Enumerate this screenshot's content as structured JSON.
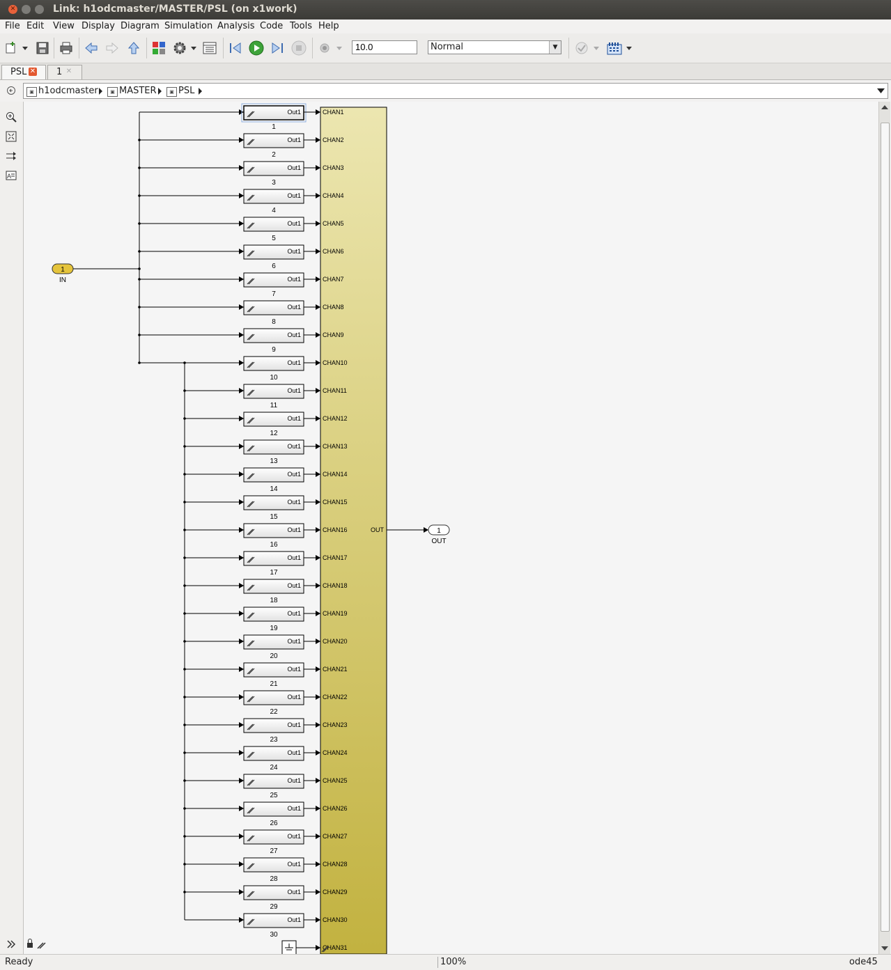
{
  "window": {
    "title": "Link: h1odcmaster/MASTER/PSL (on x1work)"
  },
  "menu": [
    "File",
    "Edit",
    "View",
    "Display",
    "Diagram",
    "Simulation",
    "Analysis",
    "Code",
    "Tools",
    "Help"
  ],
  "toolbar": {
    "stop_time": "10.0",
    "sim_mode": "Normal"
  },
  "tabs": [
    {
      "label": "PSL"
    },
    {
      "label": "1"
    }
  ],
  "breadcrumb": [
    "h1odcmaster",
    "MASTER",
    "PSL"
  ],
  "diagram": {
    "inport": {
      "number": "1",
      "label": "IN"
    },
    "outport": {
      "number": "1",
      "label": "OUT"
    },
    "link_block_port": "Out1",
    "link_blocks": [
      "1",
      "2",
      "3",
      "4",
      "5",
      "6",
      "7",
      "8",
      "9",
      "10",
      "11",
      "12",
      "13",
      "14",
      "15",
      "16",
      "17",
      "18",
      "19",
      "20",
      "21",
      "22",
      "23",
      "24",
      "25",
      "26",
      "27",
      "28",
      "29",
      "30"
    ],
    "mux_inputs": [
      "CHAN1",
      "CHAN2",
      "CHAN3",
      "CHAN4",
      "CHAN5",
      "CHAN6",
      "CHAN7",
      "CHAN8",
      "CHAN9",
      "CHAN10",
      "CHAN11",
      "CHAN12",
      "CHAN13",
      "CHAN14",
      "CHAN15",
      "CHAN16",
      "CHAN17",
      "CHAN18",
      "CHAN19",
      "CHAN20",
      "CHAN21",
      "CHAN22",
      "CHAN23",
      "CHAN24",
      "CHAN25",
      "CHAN26",
      "CHAN27",
      "CHAN28",
      "CHAN29",
      "CHAN30",
      "CHAN31"
    ],
    "mux_output": "OUT"
  },
  "status": {
    "left": "Ready",
    "zoom": "100%",
    "solver": "ode45"
  }
}
